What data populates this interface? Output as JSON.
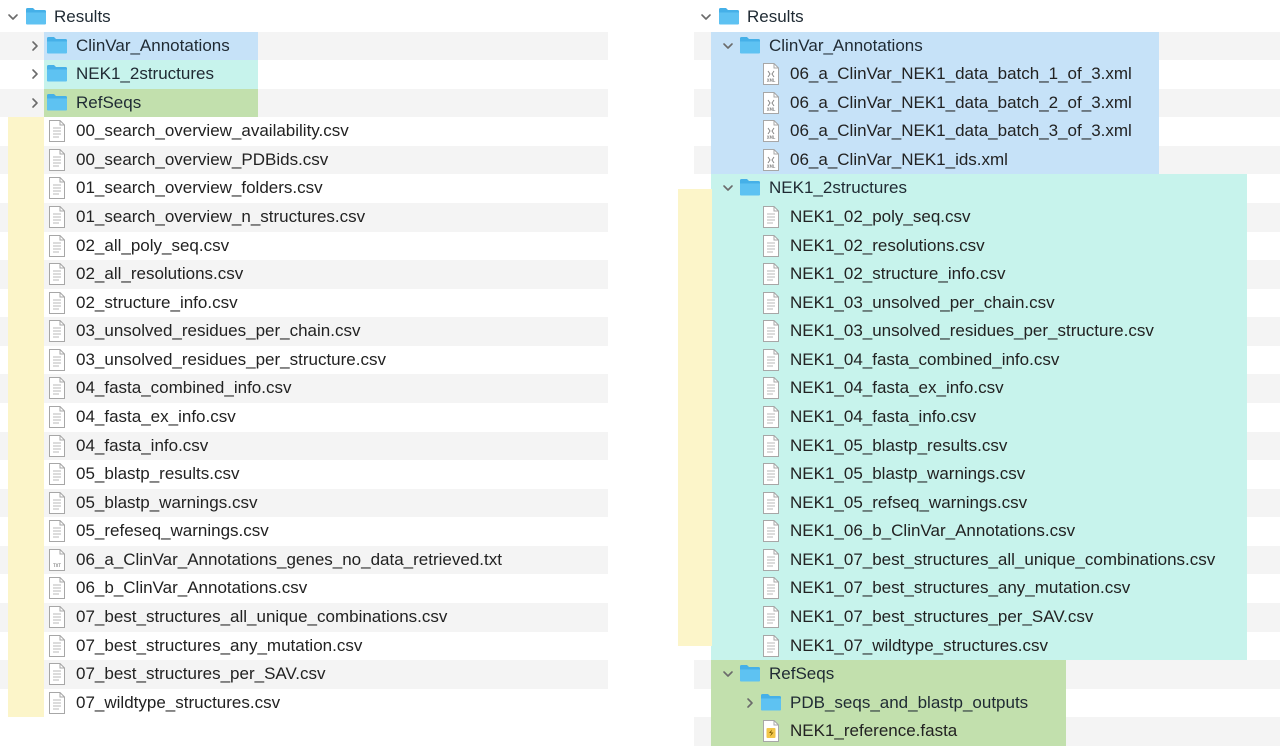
{
  "colors": {
    "blue": "#c6e2f8",
    "cyan": "#c7f3ec",
    "green": "#c2e0ad",
    "yellow": "#fcf5c9",
    "folder": "#45b0e8"
  },
  "left": {
    "root": "Results",
    "folders": [
      "ClinVar_Annotations",
      "NEK1_2structures",
      "RefSeqs"
    ],
    "files": [
      "00_search_overview_availability.csv",
      "00_search_overview_PDBids.csv",
      "01_search_overview_folders.csv",
      "01_search_overview_n_structures.csv",
      "02_all_poly_seq.csv",
      "02_all_resolutions.csv",
      "02_structure_info.csv",
      "03_unsolved_residues_per_chain.csv",
      "03_unsolved_residues_per_structure.csv",
      "04_fasta_combined_info.csv",
      "04_fasta_ex_info.csv",
      "04_fasta_info.csv",
      "05_blastp_results.csv",
      "05_blastp_warnings.csv",
      "05_refeseq_warnings.csv",
      "06_a_ClinVar_Annotations_genes_no_data_retrieved.txt",
      "06_b_ClinVar_Annotations.csv",
      "07_best_structures_all_unique_combinations.csv",
      "07_best_structures_any_mutation.csv",
      "07_best_structures_per_SAV.csv",
      "07_wildtype_structures.csv"
    ],
    "file_icons": [
      "doc",
      "doc",
      "doc",
      "doc",
      "doc",
      "doc",
      "doc",
      "doc",
      "doc",
      "doc",
      "doc",
      "doc",
      "doc",
      "doc",
      "doc",
      "txt",
      "doc",
      "doc",
      "doc",
      "doc",
      "doc"
    ]
  },
  "right": {
    "root": "Results",
    "clinvar": {
      "name": "ClinVar_Annotations",
      "files": [
        "06_a_ClinVar_NEK1_data_batch_1_of_3.xml",
        "06_a_ClinVar_NEK1_data_batch_2_of_3.xml",
        "06_a_ClinVar_NEK1_data_batch_3_of_3.xml",
        "06_a_ClinVar_NEK1_ids.xml"
      ]
    },
    "nek1": {
      "name": "NEK1_2structures",
      "files": [
        "NEK1_02_poly_seq.csv",
        "NEK1_02_resolutions.csv",
        "NEK1_02_structure_info.csv",
        "NEK1_03_unsolved_per_chain.csv",
        "NEK1_03_unsolved_residues_per_structure.csv",
        "NEK1_04_fasta_combined_info.csv",
        "NEK1_04_fasta_ex_info.csv",
        "NEK1_04_fasta_info.csv",
        "NEK1_05_blastp_results.csv",
        "NEK1_05_blastp_warnings.csv",
        "NEK1_05_refseq_warnings.csv",
        "NEK1_06_b_ClinVar_Annotations.csv",
        "NEK1_07_best_structures_all_unique_combinations.csv",
        "NEK1_07_best_structures_any_mutation.csv",
        "NEK1_07_best_structures_per_SAV.csv",
        "NEK1_07_wildtype_structures.csv"
      ]
    },
    "refseqs": {
      "name": "RefSeqs",
      "subfolder": "PDB_seqs_and_blastp_outputs",
      "file": "NEK1_reference.fasta"
    }
  }
}
